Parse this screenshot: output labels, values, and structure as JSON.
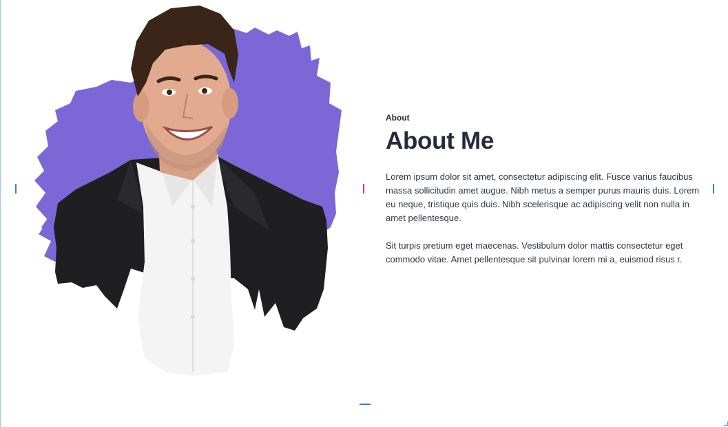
{
  "about_section": {
    "eyebrow": "About",
    "heading": "About Me",
    "paragraphs": [
      "Lorem ipsum dolor sit amet, consectetur adipiscing elit. Fusce varius faucibus massa sollicitudin amet augue. Nibh metus a semper purus mauris duis. Lorem eu neque, tristique quis duis. Nibh scelerisque ac adipiscing velit non nulla in amet pellentesque.",
      "Sit turpis pretium eget maecenas. Vestibulum dolor mattis consectetur eget commodo vitae. Amet pellentesque sit pulvinar lorem mi a, euismod risus r."
    ]
  },
  "colors": {
    "brush_accent": "#7b68d6",
    "heading_text": "#262a3b",
    "guide_blue": "#2f7de1",
    "guide_pink": "#d6337a"
  },
  "icons": {
    "portrait": "smiling-man-photo"
  }
}
